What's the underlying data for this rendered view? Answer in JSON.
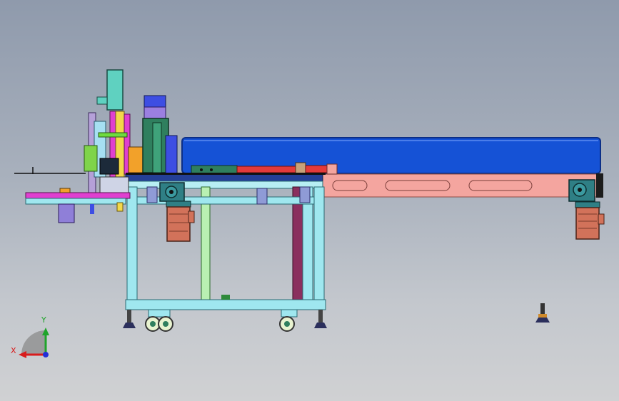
{
  "viewport": {
    "background_top": "#8f9aac",
    "background_bottom": "#d0d1d3",
    "model": "conveyor-machine-assembly-front-view"
  },
  "triad": {
    "x_label": "X",
    "y_label": "Y",
    "x_color": "#d81c1c",
    "y_color": "#1fa42a",
    "z_color": "#2330d6"
  },
  "colors": {
    "belt": "#1552d6",
    "belt_edge": "#0c2f87",
    "frame_side": "#f4a59f",
    "motor": "#d2725a",
    "gearbox": "#2f7f85",
    "table_frame": "#9fe7ef",
    "table_top": "#243f96",
    "rod": "#e43a3a",
    "cylinder": "#2f7f5e",
    "magenta": "#e040d0",
    "yellow": "#f3d84a",
    "orange": "#f2a12a"
  }
}
